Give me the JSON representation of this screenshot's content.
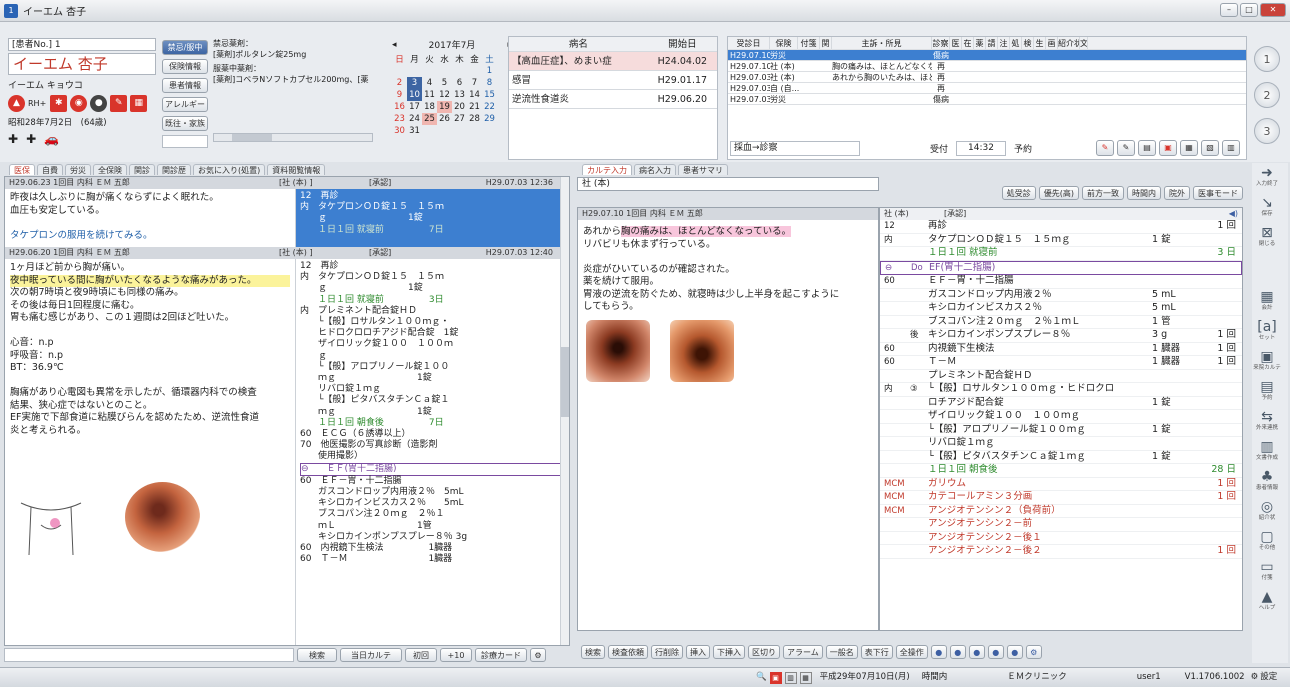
{
  "window": {
    "number": "1",
    "title": "イーエム 杏子"
  },
  "patient": {
    "no_label": "[患者No.] 1",
    "name": "イーエム 杏子",
    "kana": "イーエム キョウコ",
    "birth": "昭和28年7月2日　(64歳)",
    "rh": "RH+",
    "buttons": [
      "禁忌/服中",
      "保険情報",
      "患者情報",
      "アレルギー",
      "既往・家族"
    ],
    "prohibited_label": "禁忌薬剤：",
    "prohibited_value": "[薬剤]ポルタレン錠25mg",
    "current_label": "服薬中薬剤：",
    "current_value": "[薬剤]コベラNソフトカプセル200mg、[薬"
  },
  "calendar": {
    "month": "2017年7月",
    "weekdays": [
      "日",
      "月",
      "火",
      "水",
      "木",
      "金",
      "土"
    ],
    "weeks": [
      [
        "",
        "",
        "",
        "",
        "",
        "",
        "1"
      ],
      [
        "2",
        "3",
        "4",
        "5",
        "6",
        "7",
        "8"
      ],
      [
        "9",
        "10",
        "11",
        "12",
        "13",
        "14",
        "15"
      ],
      [
        "16",
        "17",
        "18",
        "19",
        "20",
        "21",
        "22"
      ],
      [
        "23",
        "24",
        "25",
        "26",
        "27",
        "28",
        "29"
      ],
      [
        "30",
        "31",
        "",
        "",
        "",
        "",
        ""
      ]
    ]
  },
  "diagnoses": {
    "col_name": "病名",
    "col_start": "開始日",
    "rows": [
      {
        "name": "【高血圧症】、めまい症",
        "start": "H24.04.02"
      },
      {
        "name": "感冒",
        "start": "H29.01.17"
      },
      {
        "name": "逆流性食道炎",
        "start": "H29.06.20"
      }
    ]
  },
  "visits": {
    "headers": [
      "受診日",
      "保険",
      "付箋",
      "関",
      "主訴・所見",
      "診察",
      "医",
      "在",
      "薬",
      "請",
      "注",
      "処",
      "検",
      "生",
      "画",
      "紹介状",
      "文"
    ],
    "rows": [
      {
        "date": "H29.07.10",
        "ins": "労災",
        "note": "",
        "mark": "傷病"
      },
      {
        "date": "H29.07.10",
        "ins": "社 (本)",
        "note": "胸の痛みは、ほとんどなくなって...",
        "mark": "再"
      },
      {
        "date": "H29.07.03",
        "ins": "社 (本)",
        "note": "あれから胸のいたみは、ほとんど...",
        "mark": "再"
      },
      {
        "date": "H29.07.03",
        "ins": "自 (自...",
        "note": "",
        "mark": "再"
      },
      {
        "date": "H29.07.03",
        "ins": "労災",
        "note": "",
        "mark": "傷病"
      }
    ],
    "footer_select": "採血→診察",
    "reception_label": "受付",
    "reception_time": "14:32",
    "reservation_label": "予約"
  },
  "left_pane": {
    "tabs": [
      "医保",
      "自費",
      "労災",
      "全保険",
      "関診",
      "関診歴",
      "お気に入り(処置)",
      "資料閲覧情報"
    ],
    "records": [
      {
        "header": "H29.06.23 1回目 内科 ＥＭ 五郎",
        "ins_header": "[社 (本) ]",
        "kind": "[承認]",
        "ts": "H29.07.03 12:36",
        "notes": [
          "昨夜は久しぶりに胸が痛くならずによく眠れた。",
          "血圧も安定している。",
          "",
          "タケプロンの服用を続けてみる。"
        ],
        "orders": [
          "12　再診",
          "内　タケプロンＯＤ錠１５　１５ｍ",
          "　　ｇ　　　　　　　　　1錠",
          "　　１日１回 就寝前　　　　　7日"
        ]
      },
      {
        "header": "H29.06.20 1回目 内科 ＥＭ 五郎",
        "ins_header": "[社 (本) ]",
        "kind": "[承認]",
        "ts": "H29.07.03 12:40",
        "notes": [
          "1ヶ月ほど前から胸が痛い。",
          "夜中眠っている間に胸がいたくなるような痛みがあった。",
          "次の朝7時頃と夜9時頃にも同様の痛み。",
          "その後は毎日1回程度に痛む。",
          "胃も痛む感じがあり、この１週間は2回ほど吐いた。",
          "",
          "心音：n.p",
          "呼吸音：n.p",
          "BT：36.9℃",
          "",
          "胸痛があり心電図も異常を示したが、循環器内科での検査",
          "結果、狭心症ではないとのこと。",
          "EF実施で下部食道に粘膜びらんを認めたため、逆流性食道",
          "炎と考えられる。"
        ],
        "orders": [
          "12　再診",
          "内　タケプロンＯＤ錠１５　１５ｍ",
          "　　ｇ　　　　　　　　　1錠",
          "　　１日１回 就寝前　　　　　3日",
          "内　プレミネント配合錠ＨＤ",
          "　　└【般】ロサルタン１００ｍｇ・",
          "　　ヒドロクロロチアジド配合錠　1錠",
          "　　ザイロリック錠１００　１００ｍ",
          "　　ｇ",
          "　　└【般】アロプリノール錠１００",
          "　　ｍｇ　　　　　　　　　1錠",
          "　　リバロ錠１ｍｇ",
          "　　└【般】ピタバスタチンＣａ錠１",
          "　　ｍｇ　　　　　　　　　1錠",
          "　　１日１回 朝食後　　　　　7日",
          "60　ＥＣＧ（６誘導以上）",
          "70　他医撮影の写真診断（造影剤",
          "　　使用撮影）",
          "⊖　　ＥＦ(胃十二指腸)",
          "60　ＥＦ－胃・十二指腸",
          "　　ガスコンドロップ内用液２％　5mL",
          "　　キシロカインビスカス２％　　5mL",
          "　　ブスコパン注２０ｍｇ　２％１",
          "　　ｍＬ　　　　　　　　　1管",
          "　　キシロカインポンプスプレー８％ 3g",
          "60　内視鏡下生検法　　　　　1臓器",
          "60　Ｔ－Ｍ　　　　　　　　　1臓器"
        ]
      }
    ],
    "footer": [
      "検索",
      "当日カルテ",
      "初回",
      "+10",
      "診療カード"
    ]
  },
  "center_pane": {
    "tabs": [
      "カルテ入力",
      "病名入力",
      "患者サマリ"
    ],
    "ins_tab": "社 (本)",
    "record_header": "H29.07.10 1回目 内科 ＥＭ 五郎",
    "notes": [
      {
        "t": "あれから",
        "h": ""
      },
      {
        "t": "胸の痛みは、ほとんどなくなっている。",
        "h": "pink"
      },
      {
        "t": "\nリバビリも休まず行っている。\n\n炎症がひいているのが確認された。\n薬を続けて服用。\n胃液の逆流を防ぐため、就寝時は少し上半身を起こすように\nしてもらう。",
        "h": ""
      }
    ],
    "toolbar": [
      "検索",
      "検査依頼",
      "行削除",
      "挿入",
      "下挿入",
      "区切り",
      "アラーム",
      "一般名",
      "表下行",
      "全操作"
    ]
  },
  "right_pane": {
    "toolbar": [
      "処受診",
      "優先(高)",
      "前方一致",
      "時間内",
      "院外",
      "医事モード"
    ],
    "ins": "社 (本)",
    "kind": "[承認]",
    "rows": [
      {
        "a": "12",
        "b": "",
        "c": "再診",
        "d": "",
        "e": "1 回",
        "cls": ""
      },
      {
        "a": "内",
        "b": "",
        "c": "タケプロンＯＤ錠１５　１５ｍｇ",
        "d": "1 錠",
        "e": "",
        "cls": ""
      },
      {
        "a": "",
        "b": "",
        "c": "１日１回 就寝前",
        "d": "",
        "e": "3 日",
        "cls": "green"
      },
      {
        "a": "⊖",
        "b": "Do",
        "c": "EF(胃十二指腸)",
        "d": "",
        "e": "",
        "cls": "box"
      },
      {
        "a": "60",
        "b": "",
        "c": "ＥＦ－胃・十二指腸",
        "d": "",
        "e": "",
        "cls": ""
      },
      {
        "a": "",
        "b": "",
        "c": "ガスコンドロップ内用液２％",
        "d": "5 mL",
        "e": "",
        "cls": ""
      },
      {
        "a": "",
        "b": "",
        "c": "キシロカインビスカス２％",
        "d": "5 mL",
        "e": "",
        "cls": ""
      },
      {
        "a": "",
        "b": "",
        "c": "ブスコパン注２０ｍｇ　２％１ｍＬ",
        "d": "1 管",
        "e": "",
        "cls": ""
      },
      {
        "a": "",
        "b": "後",
        "c": "キシロカインポンプスプレー８％",
        "d": "3 g",
        "e": "1 回",
        "cls": ""
      },
      {
        "a": "60",
        "b": "",
        "c": "内視鏡下生検法",
        "d": "1 臓器",
        "e": "1 回",
        "cls": ""
      },
      {
        "a": "60",
        "b": "",
        "c": "Ｔ－Ｍ",
        "d": "1 臓器",
        "e": "1 回",
        "cls": ""
      },
      {
        "a": "",
        "b": "",
        "c": "プレミネント配合錠ＨＤ",
        "d": "",
        "e": "",
        "cls": ""
      },
      {
        "a": "内",
        "b": "③",
        "c": "└【般】ロサルタン１００ｍｇ・ヒドロクロ",
        "d": "",
        "e": "",
        "cls": ""
      },
      {
        "a": "",
        "b": "",
        "c": "ロチアジド配合錠",
        "d": "1 錠",
        "e": "",
        "cls": ""
      },
      {
        "a": "",
        "b": "",
        "c": "ザイロリック錠１００　１００ｍｇ",
        "d": "",
        "e": "",
        "cls": ""
      },
      {
        "a": "",
        "b": "",
        "c": "└【般】アロプリノール錠１００ｍｇ",
        "d": "1 錠",
        "e": "",
        "cls": ""
      },
      {
        "a": "",
        "b": "",
        "c": "リバロ錠１ｍｇ",
        "d": "",
        "e": "",
        "cls": ""
      },
      {
        "a": "",
        "b": "",
        "c": "└【般】ピタバスタチンＣａ錠１ｍｇ",
        "d": "1 錠",
        "e": "",
        "cls": ""
      },
      {
        "a": "",
        "b": "",
        "c": "１日１回 朝食後",
        "d": "",
        "e": "28 日",
        "cls": "green"
      },
      {
        "a": "MCM",
        "b": "",
        "c": "ガリウム",
        "d": "",
        "e": "1 回",
        "cls": "red"
      },
      {
        "a": "MCM",
        "b": "",
        "c": "カテコールアミン３分画",
        "d": "",
        "e": "1 回",
        "cls": "red"
      },
      {
        "a": "MCM",
        "b": "",
        "c": "アンジオテンシン２（負荷前）",
        "d": "",
        "e": "",
        "cls": "red"
      },
      {
        "a": "",
        "b": "",
        "c": "アンジオテンシン２－前",
        "d": "",
        "e": "",
        "cls": "red"
      },
      {
        "a": "",
        "b": "",
        "c": "アンジオテンシン２－後１",
        "d": "",
        "e": "",
        "cls": "red"
      },
      {
        "a": "",
        "b": "",
        "c": "アンジオテンシン２－後２",
        "d": "",
        "e": "1 回",
        "cls": "red"
      }
    ]
  },
  "sidebar": [
    "入力終了",
    "保存",
    "閉じる",
    "",
    "会計",
    "セット",
    "来院カルテ",
    "予約",
    "外来連携",
    "文書作成",
    "患者情報",
    "紹介状",
    "その他",
    "付箋",
    "ヘルプ"
  ],
  "status": {
    "date": "平成29年07月10日(月)",
    "time_slot": "時間内",
    "clinic": "ＥＭクリニック",
    "user": "user1",
    "version": "V1.1706.1002",
    "settings": "設定"
  }
}
